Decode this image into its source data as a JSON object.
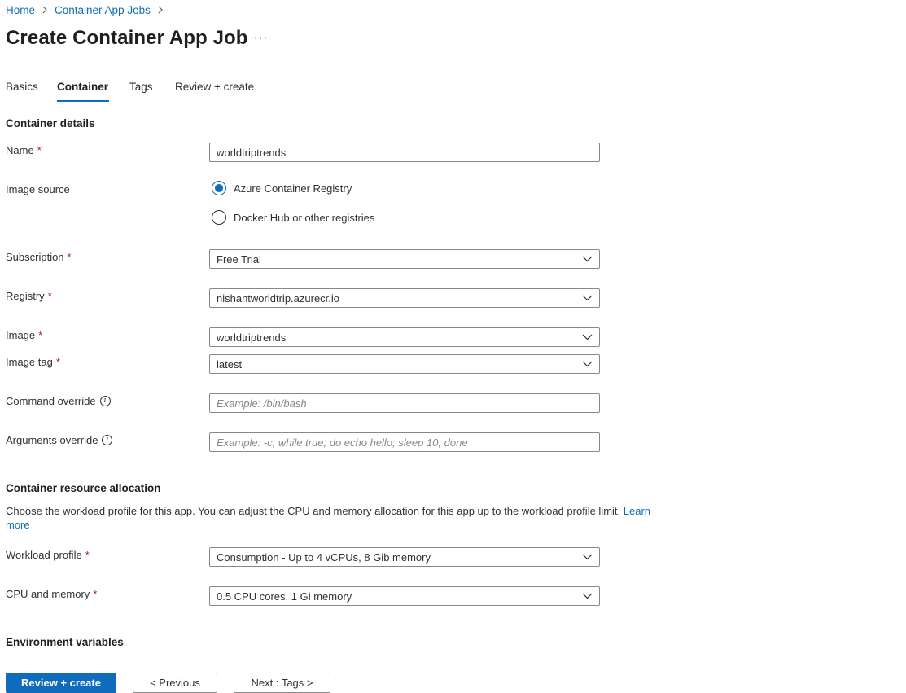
{
  "breadcrumb": {
    "items": [
      "Home",
      "Container App Jobs"
    ],
    "separator": ">"
  },
  "page": {
    "title": "Create Container App Job",
    "more_label": "···"
  },
  "tabs": [
    {
      "label": "Basics",
      "active": false
    },
    {
      "label": "Container",
      "active": true
    },
    {
      "label": "Tags",
      "active": false
    },
    {
      "label": "Review + create",
      "active": false
    }
  ],
  "container_details": {
    "heading": "Container details",
    "name": {
      "label": "Name",
      "required": "*",
      "value": "worldtriptrends"
    },
    "image_source": {
      "label": "Image source",
      "options": [
        {
          "label": "Azure Container Registry",
          "checked": true
        },
        {
          "label": "Docker Hub or other registries",
          "checked": false
        }
      ]
    },
    "subscription": {
      "label": "Subscription",
      "required": "*",
      "value": "Free Trial"
    },
    "registry": {
      "label": "Registry",
      "required": "*",
      "value": "nishantworldtrip.azurecr.io"
    },
    "image": {
      "label": "Image",
      "required": "*",
      "value": "worldtriptrends"
    },
    "image_tag": {
      "label": "Image tag",
      "required": "*",
      "value": "latest"
    },
    "command_override": {
      "label": "Command override",
      "placeholder": "Example: /bin/bash",
      "value": ""
    },
    "arguments_override": {
      "label": "Arguments override",
      "placeholder": "Example: -c, while true; do echo hello; sleep 10; done",
      "value": ""
    }
  },
  "resource_allocation": {
    "heading": "Container resource allocation",
    "description": "Choose the workload profile for this app. You can adjust the CPU and memory allocation for this app up to the workload profile limit.",
    "learn_more": "Learn more",
    "workload_profile": {
      "label": "Workload profile",
      "required": "*",
      "value": "Consumption - Up to 4 vCPUs, 8 Gib memory"
    },
    "cpu_memory": {
      "label": "CPU and memory",
      "required": "*",
      "value": "0.5 CPU cores, 1 Gi memory"
    }
  },
  "environment_variables": {
    "heading": "Environment variables"
  },
  "footer": {
    "review_create": "Review + create",
    "previous": "< Previous",
    "next": "Next : Tags >"
  },
  "colors": {
    "accent": "#0f6cbd",
    "required": "#a4262c",
    "text": "#323130"
  },
  "icons": {
    "info": "info-icon",
    "chevron": "chevron-down-icon",
    "breadcrumb_sep": "chevron-right-icon"
  }
}
